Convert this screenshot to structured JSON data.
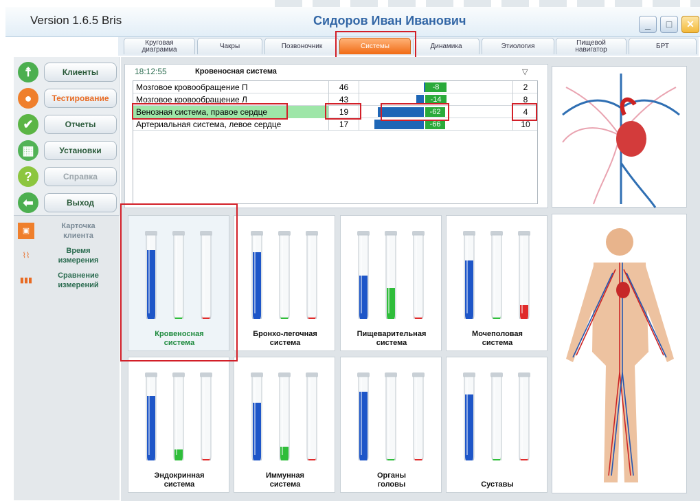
{
  "header": {
    "version": "Version  1.6.5  Bris",
    "user": "Сидоров  Иван  Иванович",
    "minimize": "_",
    "maximize": "□",
    "close": "✕"
  },
  "tabs": [
    {
      "label": "Круговая\nдиаграмма",
      "active": false
    },
    {
      "label": "Чакры",
      "active": false
    },
    {
      "label": "Позвоночник",
      "active": false
    },
    {
      "label": "Системы",
      "active": true
    },
    {
      "label": "Динамика",
      "active": false
    },
    {
      "label": "Этиология",
      "active": false
    },
    {
      "label": "Пищевой\nнавигатор",
      "active": false
    },
    {
      "label": "БРТ",
      "active": false
    }
  ],
  "nav": [
    {
      "label": "Клиенты",
      "icon": "person-icon",
      "color": "#4caf50",
      "style": ""
    },
    {
      "label": "Тестирование",
      "icon": "user-test-icon",
      "color": "#ef7f2c",
      "style": "orange"
    },
    {
      "label": "Отчеты",
      "icon": "checkmark-icon",
      "color": "#5bb545",
      "style": ""
    },
    {
      "label": "Установки",
      "icon": "grid-settings-icon",
      "color": "#52b356",
      "style": ""
    },
    {
      "label": "Справка",
      "icon": "question-icon",
      "color": "#8cc63f",
      "style": "gray"
    },
    {
      "label": "Выход",
      "icon": "exit-arrow-icon",
      "color": "#4caf50",
      "style": ""
    }
  ],
  "subnav": [
    {
      "label": "Карточка\nклиента",
      "icon": "card-icon",
      "color": "#7a8a96"
    },
    {
      "label": "Время\nизмерения",
      "icon": "time-chart-icon",
      "color": "#2a6b4f"
    },
    {
      "label": "Сравнение\nизмерений",
      "icon": "compare-bars-icon",
      "color": "#2a6b4f"
    }
  ],
  "panel": {
    "time": "18:12:55",
    "title": "Кровеносная система",
    "sort": "▽"
  },
  "rows": [
    {
      "name": "Мозговое кровообращение П",
      "value": "46",
      "delta": "-8",
      "count": "2",
      "blue": 0.0,
      "greenw": 0.14,
      "highlight": false
    },
    {
      "name": "Мозговое кровообращение Л",
      "value": "43",
      "delta": "-14",
      "count": "8",
      "blue": 0.05,
      "greenw": 0.14,
      "highlight": false
    },
    {
      "name": "Венозная система, правое сердце",
      "value": "19",
      "delta": "-62",
      "count": "4",
      "blue": 0.3,
      "greenw": 0.13,
      "highlight": true
    },
    {
      "name": "Артериальная система, левое сердце",
      "value": "17",
      "delta": "-66",
      "count": "10",
      "blue": 0.32,
      "greenw": 0.13,
      "highlight": false
    }
  ],
  "systems": [
    {
      "label": "Кровеносная\nсистема",
      "levels": [
        0.85,
        0.0,
        0.0
      ],
      "selected": true
    },
    {
      "label": "Бронхо-легочная\nсистема",
      "levels": [
        0.83,
        0.0,
        0.0
      ],
      "selected": false
    },
    {
      "label": "Пищеварительная\nсистема",
      "levels": [
        0.55,
        0.4,
        0.0
      ],
      "selected": false
    },
    {
      "label": "Мочеполовая\nсистема",
      "levels": [
        0.73,
        0.0,
        0.2
      ],
      "selected": false
    },
    {
      "label": "Эндокринная\nсистема",
      "levels": [
        0.8,
        0.16,
        0.0
      ],
      "selected": false
    },
    {
      "label": "Иммунная\nсистема",
      "levels": [
        0.72,
        0.2,
        0.0
      ],
      "selected": false
    },
    {
      "label": "Органы\nголовы",
      "levels": [
        0.85,
        0.0,
        0.0
      ],
      "selected": false
    },
    {
      "label": "Суставы",
      "levels": [
        0.82,
        0.0,
        0.0
      ],
      "selected": false
    }
  ],
  "colors": {
    "blue": "#1e56c8",
    "green": "#2fbd3a",
    "red": "#e02b2b",
    "accent": "#f06a14"
  }
}
